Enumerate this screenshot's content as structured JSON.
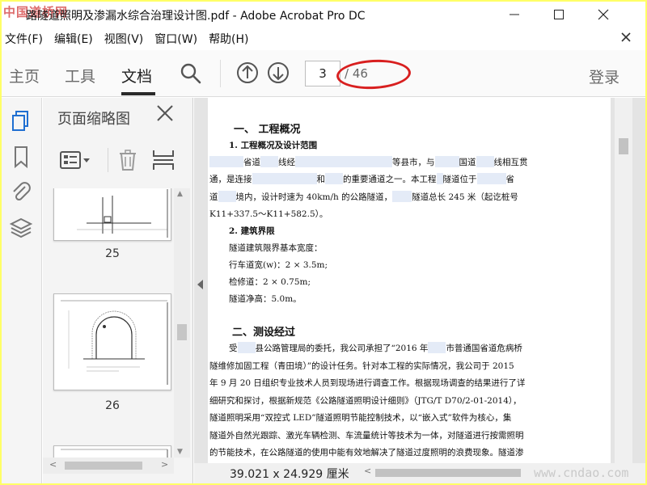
{
  "window": {
    "title": "路隧道照明及渗漏水综合治理设计图.pdf - Adobe Acrobat Pro DC",
    "watermark": "中国道桥网"
  },
  "menu": [
    "文件(F)",
    "编辑(E)",
    "视图(V)",
    "窗口(W)",
    "帮助(H)"
  ],
  "toolbar": {
    "tabs": [
      "主页",
      "工具",
      "文档"
    ],
    "active_tab": "文档",
    "current_page": "3",
    "page_total": "/ 46",
    "login": "登录"
  },
  "thumbnails": {
    "title": "页面缩略图",
    "pages": [
      "25",
      "26"
    ]
  },
  "document": {
    "heading1": "一、  工程概况",
    "sub1": "1. 工程概况及设计范围",
    "p1": [
      [
        "",
        "省道",
        "线经",
        "等县市，与",
        "国道",
        "线相互贯"
      ],
      [
        "通，是连接",
        "和",
        "的重要通道之一。本工程",
        "隧道位于",
        "省"
      ],
      [
        "道",
        "境内，设计时速为 40km/h 的公路隧道，",
        "隧道总长 245 米（起讫桩号"
      ],
      [
        "K11+337.5～K11+582.5）。"
      ]
    ],
    "sub2": "2. 建筑界限",
    "lines2": [
      "隧道建筑限界基本宽度：",
      "行车道宽(w)：2 × 3.5m;",
      "检修道：2 × 0.75m;",
      "隧道净高：5.0m。"
    ],
    "heading2": "二、测设经过",
    "p2": [
      [
        "受",
        "县公路管理局的委托，我公司承担了“2016 年",
        "市普通国省道危病桥"
      ],
      [
        "隧维修加固工程（青田境）”的设计任务。针对本工程的实际情况，我公司于 2015"
      ],
      [
        "年 9 月 20 日组织专业技术人员到现场进行调查工作。根据现场调查的结果进行了详"
      ],
      [
        "细研究和探讨，根据新规范《公路隧道照明设计细则》（JTG/T D70/2-01-2014），"
      ],
      [
        "隧道照明采用“双控式 LED”隧道照明节能控制技术，以“嵌入式”软件为核心，集"
      ],
      [
        "隧道外自然光跟踪、激光车辆检测、车流量统计等技术为一体，对隧道进行按需照明"
      ],
      [
        "的节能技术，在公路隧道的使用中能有效地解决了隧道过度照明的浪费现象。隧道渗"
      ]
    ],
    "page_size": "39.021 x 24.929 厘米",
    "site_watermark": "www.cndao.com"
  },
  "colors": {
    "highlight": "#d81f1f",
    "redaction": "#e4ebf7",
    "frame": "#ffff66"
  }
}
